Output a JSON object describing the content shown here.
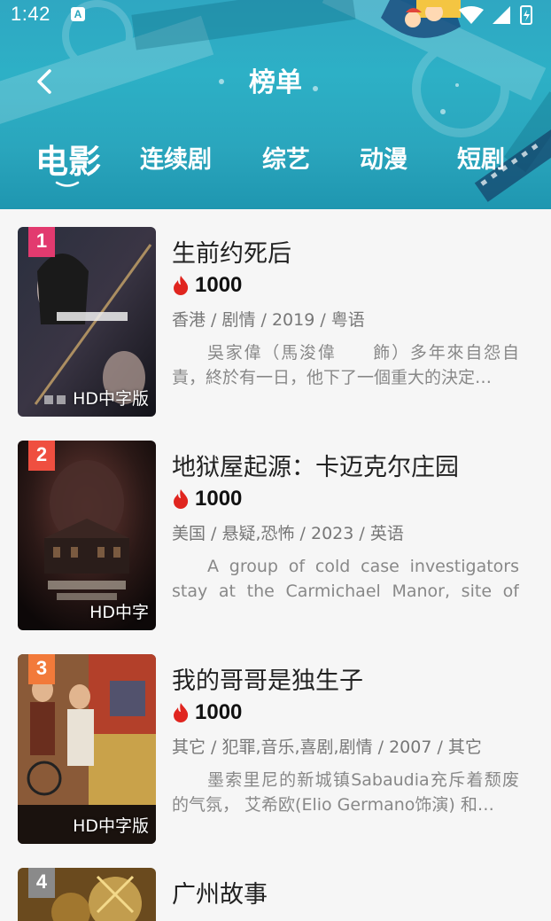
{
  "status_bar": {
    "time": "1:42",
    "notification_icon": "A"
  },
  "header": {
    "title": "榜单",
    "back_icon": "chevron-left-icon"
  },
  "tabs": [
    {
      "label": "电影",
      "active": true
    },
    {
      "label": "连续剧",
      "active": false
    },
    {
      "label": "综艺",
      "active": false
    },
    {
      "label": "动漫",
      "active": false
    },
    {
      "label": "短剧",
      "active": false
    }
  ],
  "items": [
    {
      "rank": "1",
      "rank_color": "#e23a6f",
      "quality": "HD中字版",
      "title": "生前约死后",
      "heat": "1000",
      "meta": "香港 / 剧情 / 2019 / 粤语",
      "desc": "吳家偉（馬浚偉　　飾）多年來自怨自責，終於有一日，他下了一個重大的決定…"
    },
    {
      "rank": "2",
      "rank_color": "#ef4f40",
      "quality": "HD中字",
      "title": "地狱屋起源：卡迈克尔庄园",
      "heat": "1000",
      "meta": "美国 / 悬疑,恐怖 / 2023 / 英语",
      "desc": "A group of cold case investigators stay at the Carmichael Manor, site of the…"
    },
    {
      "rank": "3",
      "rank_color": "#f27a3a",
      "quality": "HD中字版",
      "title": "我的哥哥是独生子",
      "heat": "1000",
      "meta": "其它 / 犯罪,音乐,喜剧,剧情 / 2007 / 其它",
      "desc": "墨索里尼的新城镇Sabaudia充斥着颓废的气氛， 艾希欧(Elio Germano饰演) 和…"
    },
    {
      "rank": "4",
      "rank_color": "#8a8a8a",
      "quality": "",
      "title": "广州故事",
      "heat": "",
      "meta": "",
      "desc": ""
    }
  ],
  "colors": {
    "header_bg": "#2aa6bd",
    "heat_icon": "#e0251f",
    "page_bg": "#f6f6f6"
  }
}
